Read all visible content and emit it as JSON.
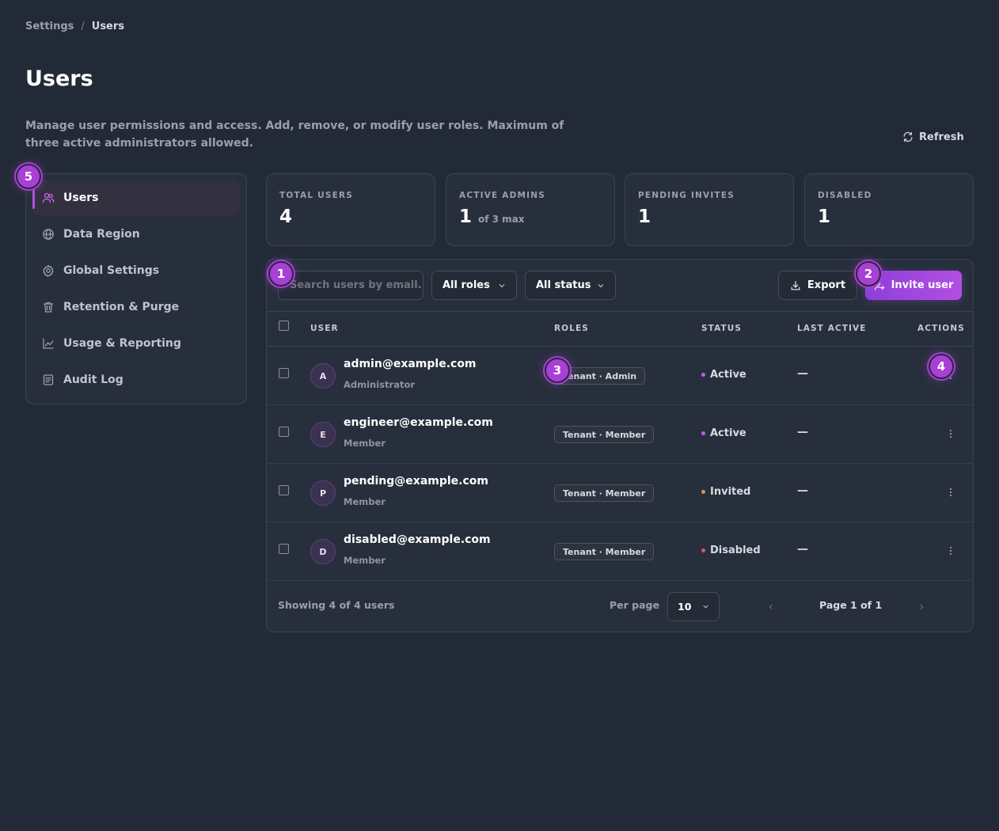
{
  "breadcrumb": {
    "parent": "Settings",
    "separator": "/",
    "current": "Users"
  },
  "page": {
    "title": "Users",
    "description": "Manage user permissions and access. Add, remove, or modify user roles. Maximum of three active administrators allowed.",
    "refresh_label": "Refresh"
  },
  "sidebar": {
    "items": [
      {
        "label": "Users",
        "icon": "users-icon",
        "active": true
      },
      {
        "label": "Data Region",
        "icon": "globe-icon",
        "active": false
      },
      {
        "label": "Global Settings",
        "icon": "gear-icon",
        "active": false
      },
      {
        "label": "Retention & Purge",
        "icon": "trash-icon",
        "active": false
      },
      {
        "label": "Usage & Reporting",
        "icon": "chart-icon",
        "active": false
      },
      {
        "label": "Audit Log",
        "icon": "log-icon",
        "active": false
      }
    ]
  },
  "stats": [
    {
      "label": "TOTAL USERS",
      "value": "4",
      "suffix": ""
    },
    {
      "label": "ACTIVE ADMINS",
      "value": "1",
      "suffix": "of 3 max"
    },
    {
      "label": "PENDING INVITES",
      "value": "1",
      "suffix": ""
    },
    {
      "label": "DISABLED",
      "value": "1",
      "suffix": ""
    }
  ],
  "toolbar": {
    "search_placeholder": "Search users by email...",
    "roles_filter": "All roles",
    "status_filter": "All status",
    "export_label": "Export",
    "invite_label": "Invite user"
  },
  "table": {
    "headers": {
      "user": "USER",
      "roles": "ROLES",
      "status": "STATUS",
      "last_active": "LAST ACTIVE",
      "actions": "ACTIONS"
    },
    "rows": [
      {
        "initial": "A",
        "email": "admin@example.com",
        "role": "Administrator",
        "badge": "Tenant · Admin",
        "status": "Active",
        "status_color": "#c25ce6",
        "last_active": "—"
      },
      {
        "initial": "E",
        "email": "engineer@example.com",
        "role": "Member",
        "badge": "Tenant · Member",
        "status": "Active",
        "status_color": "#c25ce6",
        "last_active": "—"
      },
      {
        "initial": "P",
        "email": "pending@example.com",
        "role": "Member",
        "badge": "Tenant · Member",
        "status": "Invited",
        "status_color": "#e8923a",
        "last_active": "—"
      },
      {
        "initial": "D",
        "email": "disabled@example.com",
        "role": "Member",
        "badge": "Tenant · Member",
        "status": "Disabled",
        "status_color": "#e2505f",
        "last_active": "—"
      }
    ]
  },
  "footer": {
    "showing": "Showing 4 of 4 users",
    "per_page_label": "Per page",
    "per_page_value": "10",
    "page_info": "Page 1 of 1"
  },
  "markers": [
    "1",
    "2",
    "3",
    "4",
    "5"
  ],
  "colors": {
    "accent": "#b04fe0",
    "background": "#222a37",
    "panel": "#272f3c"
  }
}
